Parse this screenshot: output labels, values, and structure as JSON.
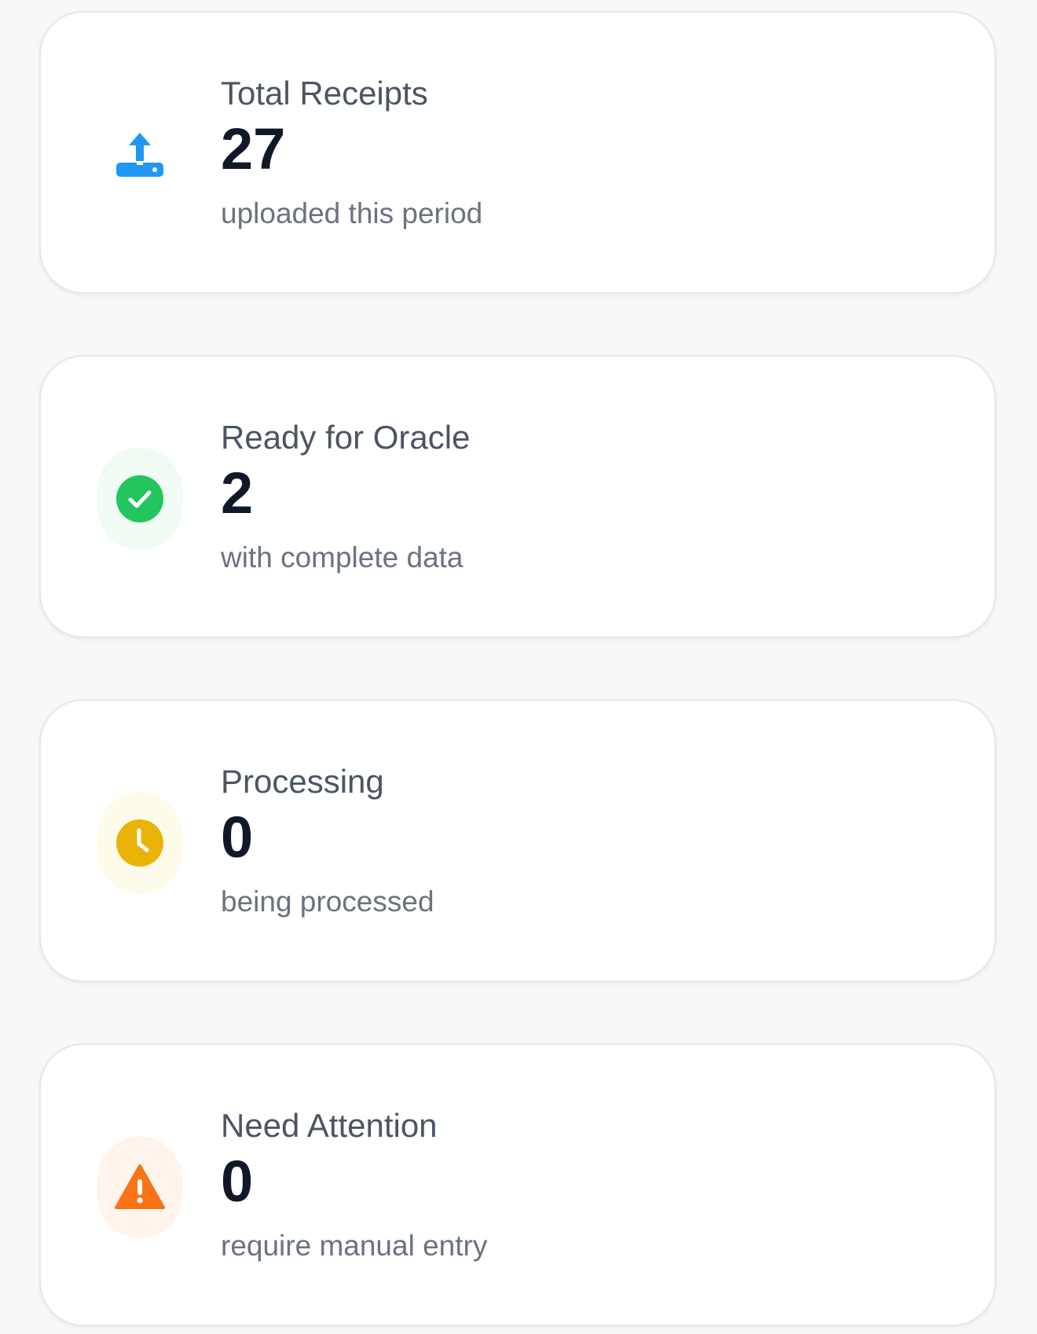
{
  "cards": [
    {
      "title": "Total Receipts",
      "value": "27",
      "subtitle": "uploaded this period",
      "icon": "upload-icon",
      "icon_color": "#2196f3",
      "icon_bg": "transparent"
    },
    {
      "title": "Ready for Oracle",
      "value": "2",
      "subtitle": "with complete data",
      "icon": "check-circle-icon",
      "icon_color": "#22c55e",
      "icon_bg": "#f0fbf3"
    },
    {
      "title": "Processing",
      "value": "0",
      "subtitle": "being processed",
      "icon": "clock-icon",
      "icon_color": "#eab308",
      "icon_bg": "#fffbea"
    },
    {
      "title": "Need Attention",
      "value": "0",
      "subtitle": "require manual entry",
      "icon": "warning-icon",
      "icon_color": "#f97316",
      "icon_bg": "#fff4ec"
    }
  ]
}
